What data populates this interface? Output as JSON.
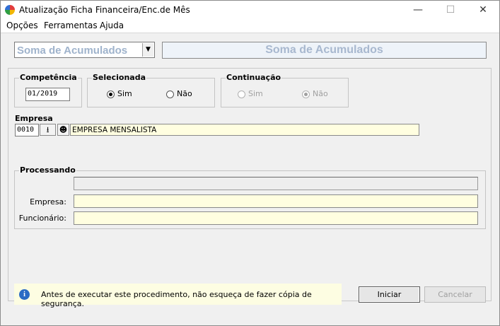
{
  "window": {
    "title": "Atualização Ficha Financeira/Enc.de Mês",
    "minimize": "—",
    "maximize": "☐",
    "close": "✕"
  },
  "menu": [
    {
      "label": "Opções"
    },
    {
      "label": "Ferramentas"
    },
    {
      "label": "Ajuda"
    }
  ],
  "header": {
    "combo_value": "Soma de Acumulados",
    "banner": "Soma de Acumulados"
  },
  "competencia": {
    "title": "Competência",
    "value": "01/2019"
  },
  "selecionada": {
    "title": "Selecionada",
    "opt_sim": "Sim",
    "opt_nao": "Não",
    "selected": "Sim"
  },
  "continuacao": {
    "title": "Continuação",
    "opt_sim": "Sim",
    "opt_nao": "Não",
    "selected": "Não",
    "enabled": false
  },
  "empresa": {
    "label": "Empresa",
    "code": "0010",
    "name": "EMPRESA MENSALISTA"
  },
  "processando": {
    "title": "Processando",
    "empresa_label": "Empresa:",
    "funcionario_label": "Funcionário:",
    "empresa_value": "",
    "funcionario_value": ""
  },
  "info": {
    "text": "Antes de executar este procedimento, não esqueça de fazer cópia de segurança."
  },
  "buttons": {
    "iniciar": "Iniciar",
    "cancelar": "Cancelar"
  }
}
